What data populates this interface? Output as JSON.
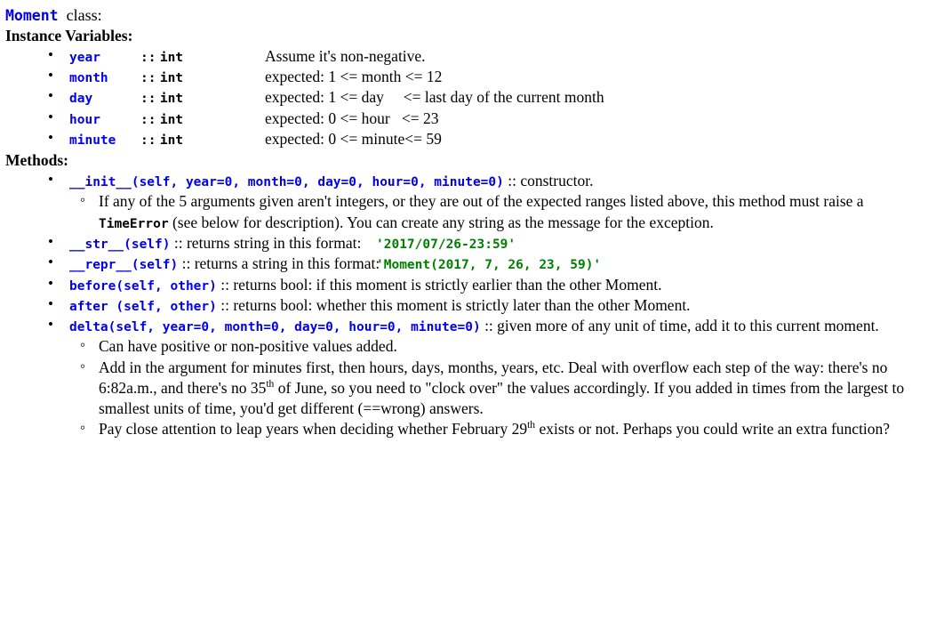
{
  "colors": {
    "code_blue": "#0000ee",
    "code_green": "#008000",
    "text_black": "#000000",
    "background": "#ffffff"
  },
  "header": {
    "class_name": "Moment",
    "class_suffix": "class:"
  },
  "sections": {
    "instance_variables": {
      "heading": "Instance Variables:",
      "rows": [
        {
          "name": "year",
          "sep": "::",
          "type": "int",
          "desc": "Assume it's non-negative."
        },
        {
          "name": "month",
          "sep": "::",
          "type": "int",
          "desc": "expected: 1 <= month <= 12"
        },
        {
          "name": "day",
          "sep": "::",
          "type": "int",
          "desc": "expected: 1 <= day     <= last day of the current month"
        },
        {
          "name": "hour",
          "sep": "::",
          "type": "int",
          "desc": "expected: 0 <= hour   <= 23"
        },
        {
          "name": "minute",
          "sep": "::",
          "type": "int",
          "desc": "expected: 0 <= minute<= 59"
        }
      ]
    },
    "methods": {
      "heading": "Methods:",
      "init": {
        "signature": "__init__(self, year=0, month=0, day=0, hour=0, minute=0)",
        "sep": "::",
        "description": "constructor.",
        "notes": [
          {
            "part1": "If any of the 5 arguments given aren't integers, or they are out of the expected ranges listed above, this method must raise a ",
            "code": "TimeError",
            "part2": " (see below for description). You can create any string as the message for the exception."
          }
        ]
      },
      "str": {
        "signature": "__str__(self)",
        "sep": "::",
        "description": "returns string in this format:",
        "example": "'2017/07/26-23:59'"
      },
      "repr": {
        "signature": "__repr__(self)",
        "sep": "::",
        "description": "returns a string in this format:",
        "example": "'Moment(2017, 7, 26, 23, 59)'"
      },
      "before": {
        "signature": "before(self, other)",
        "sep": "::",
        "description": "returns bool: if this moment is strictly earlier than the other Moment."
      },
      "after": {
        "signature": "after (self, other)",
        "sep": "::",
        "description": "returns bool: whether this moment is strictly later than the other Moment."
      },
      "delta": {
        "signature": "delta(self, year=0, month=0, day=0, hour=0, minute=0)",
        "sep": "::",
        "description": "given more of any unit of time, add it to this current moment.",
        "notes": [
          {
            "text": "Can have positive or non-positive values added."
          },
          {
            "part1": "Add in the argument for minutes first, then hours, days, months, years, etc. Deal with overflow each step of the way: there's no 6:82a.m., and there's no 35",
            "sup1": "th",
            "part2": " of June, so you need to \"clock over\" the values accordingly. If you added in times from the largest to smallest units of time, you'd get different (==wrong) answers."
          },
          {
            "part1": "Pay close attention to leap years when deciding whether February 29",
            "sup1": "th",
            "part2": " exists or not. Perhaps you could write an extra function?"
          }
        ]
      }
    }
  }
}
